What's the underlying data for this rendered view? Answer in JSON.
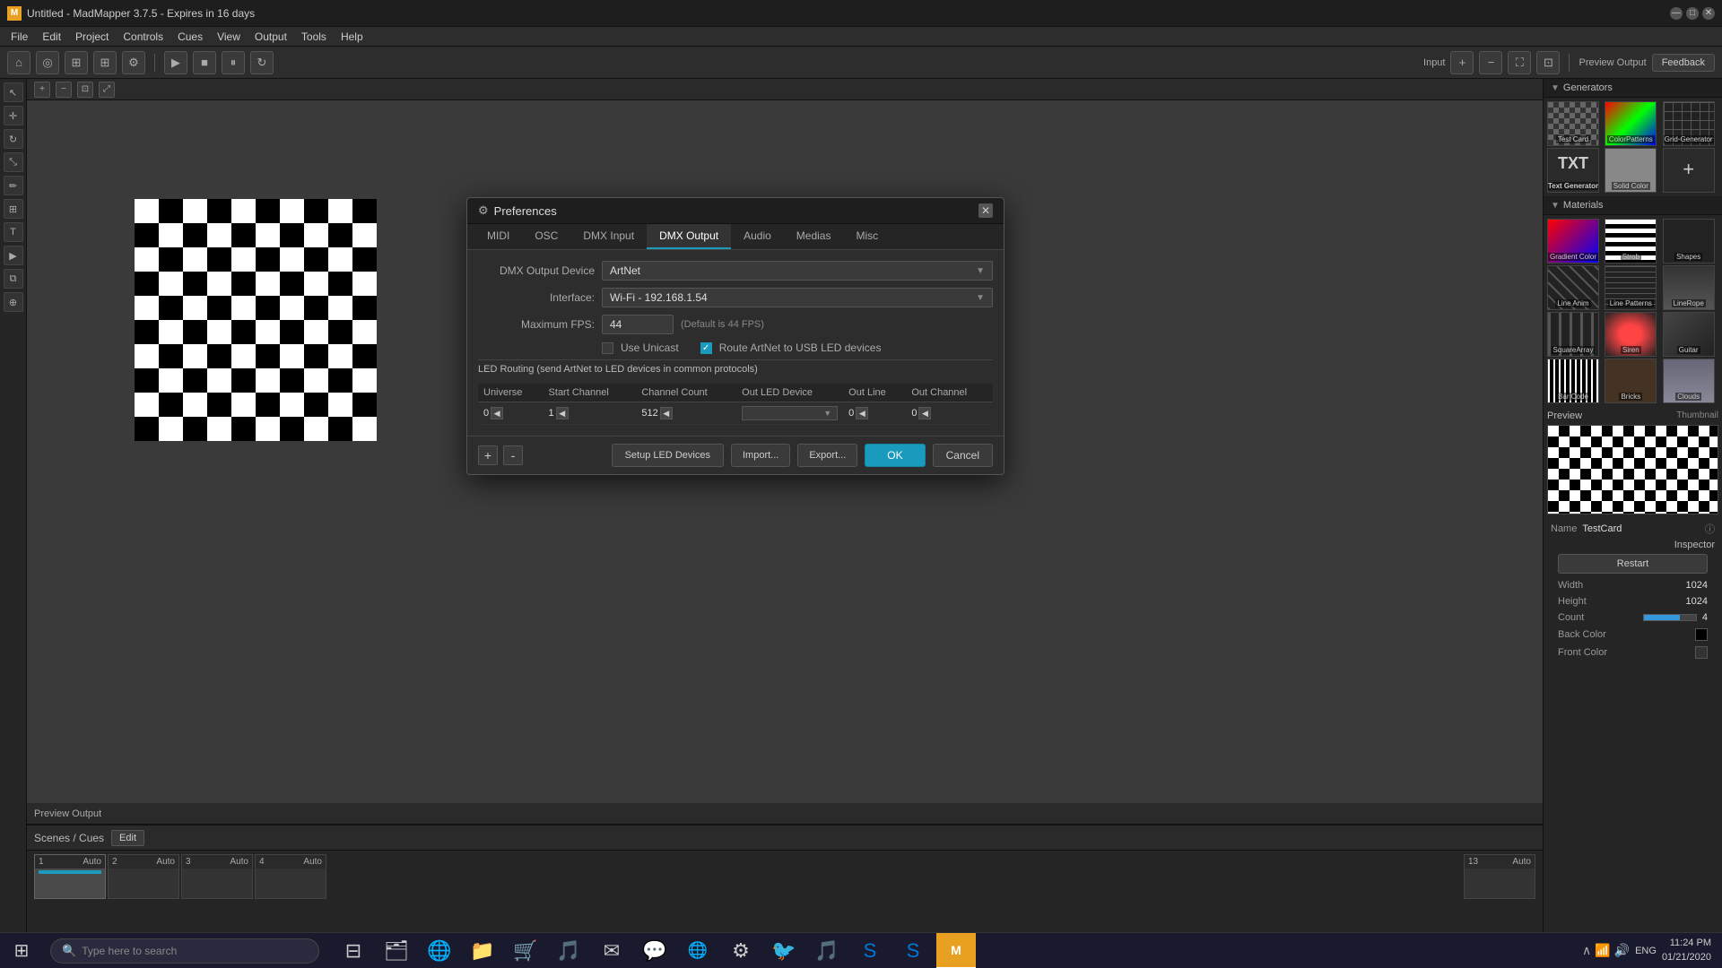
{
  "window": {
    "title": "Untitled - MadMapper 3.7.5 - Expires in 16 days",
    "controls": {
      "minimize": "—",
      "maximize": "□",
      "close": "✕"
    }
  },
  "menu": {
    "items": [
      "File",
      "Edit",
      "Project",
      "Controls",
      "Cues",
      "View",
      "Output",
      "Tools",
      "Help"
    ]
  },
  "toolbar": {
    "input_label": "Input",
    "preview_output_label": "Preview Output",
    "feedback_label": "Feedback"
  },
  "preferences": {
    "title": "Preferences",
    "close_btn": "✕",
    "tabs": [
      "MIDI",
      "OSC",
      "DMX Input",
      "DMX Output",
      "Audio",
      "Medias",
      "Misc"
    ],
    "active_tab": "DMX Output",
    "fields": {
      "device_label": "DMX Output Device",
      "device_value": "ArtNet",
      "interface_label": "Interface:",
      "interface_value": "Wi-Fi - 192.168.1.54",
      "fps_label": "Maximum FPS:",
      "fps_value": "44",
      "fps_hint": "(Default is 44 FPS)",
      "use_unicast_label": "Use Unicast",
      "route_artnet_label": "Route ArtNet to USB LED devices"
    },
    "led_routing": {
      "section_label": "LED Routing (send ArtNet to LED devices in common protocols)",
      "columns": [
        "Universe",
        "Start Channel",
        "Channel Count",
        "Out LED Device",
        "Out Line",
        "Out Channel"
      ],
      "rows": [
        {
          "universe": "0",
          "start_channel": "1",
          "channel_count": "512",
          "out_led_device": "",
          "out_line": "0",
          "out_channel": "0"
        }
      ]
    },
    "footer": {
      "add_btn": "+",
      "remove_btn": "-",
      "setup_led_devices": "Setup LED Devices",
      "import_btn": "Import...",
      "export_btn": "Export...",
      "ok_btn": "OK",
      "cancel_btn": "Cancel"
    }
  },
  "generators": {
    "section_label": "Generators",
    "items": [
      {
        "name": "Test Card",
        "type": "checker"
      },
      {
        "name": "ColorPatterns",
        "type": "color"
      },
      {
        "name": "Grid-Generator",
        "type": "grid"
      },
      {
        "name": "Text Generator",
        "type": "txt"
      },
      {
        "name": "Solid Color",
        "type": "solid"
      },
      {
        "name": "+",
        "type": "plus"
      },
      {
        "name": "Strob",
        "type": "strob"
      },
      {
        "name": "Shapes",
        "type": "shapes"
      },
      {
        "name": "Line Anim",
        "type": "lineanim"
      },
      {
        "name": "Line Patterns",
        "type": "linepatterns"
      },
      {
        "name": "LineRope",
        "type": "linerope"
      },
      {
        "name": "SquareArray",
        "type": "square"
      },
      {
        "name": "Siren",
        "type": "siren"
      },
      {
        "name": "Guitar",
        "type": "guitar"
      },
      {
        "name": "Bar Code",
        "type": "barcode"
      },
      {
        "name": "Bricks",
        "type": "bricks"
      },
      {
        "name": "Clouds",
        "type": "clouds"
      }
    ]
  },
  "materials": {
    "section_label": "Materials"
  },
  "preview": {
    "label": "Preview",
    "thumbnail_label": "Thumbnail",
    "name_label": "Name",
    "name_value": "TestCard",
    "info_btn": "ⓘ",
    "restart_btn": "Restart",
    "width_label": "Width",
    "width_value": "1024",
    "height_label": "Height",
    "height_value": "1024",
    "count_label": "Count",
    "count_value": "4",
    "back_color_label": "Back Color",
    "front_color_label": "Front Color"
  },
  "inspector": {
    "label": "Inspector"
  },
  "scenes": {
    "label": "Scenes / Cues",
    "edit_btn": "Edit",
    "items": [
      {
        "number": "1",
        "auto": "Auto"
      },
      {
        "number": "2",
        "auto": "Auto"
      },
      {
        "number": "3",
        "auto": "Auto"
      },
      {
        "number": "4",
        "auto": "Auto"
      },
      {
        "number": "13",
        "auto": "Auto"
      }
    ]
  },
  "taskbar": {
    "search_placeholder": "Type here to search",
    "time": "11:24 PM",
    "date": "01/21/2020",
    "language": "ENG",
    "apps": [
      "⊞",
      "🔍",
      "🗂",
      "🌐",
      "📁",
      "🛒",
      "🎵",
      "✉",
      "💬",
      "🌐",
      "🛡",
      "🐦",
      "🎵",
      "💬",
      "🟠"
    ]
  }
}
